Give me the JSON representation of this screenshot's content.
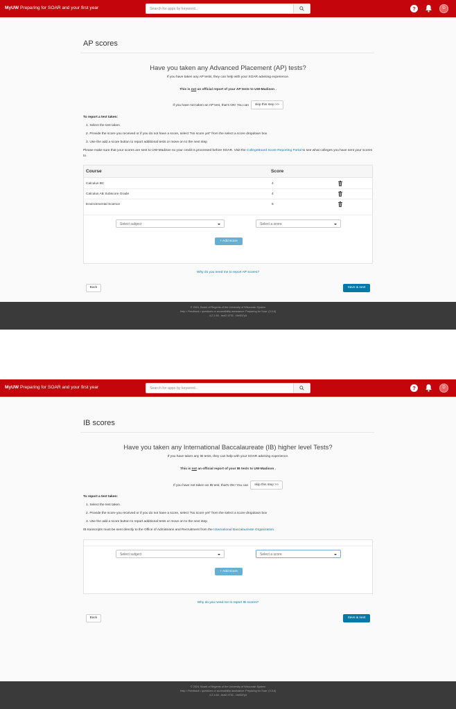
{
  "header": {
    "brand_bold": "MyUW",
    "brand_rest": " Preparing for SOAR and your first year",
    "search_placeholder": "Search for apps by keyword...",
    "avatar_letter": "D",
    "help_glyph": "?"
  },
  "ap": {
    "title": "AP scores",
    "question": "Have you taken any Advanced Placement (AP) tests?",
    "subtext": "If you have taken any AP tests, they can help with your SOAR advising experience.",
    "official_pre": "This is ",
    "official_not": "not",
    "official_post": " an official report of your AP tests to UW-Madison .",
    "skip_prompt": "If you have not taken an AP test, that's OK! You can",
    "skip_label": "skip this step >>",
    "instructions_head": "To report a test taken:",
    "instructions": [
      "1. Select the test taken",
      "2. Provide the score you received or if you do not have a score, select \"No score yet\" from the select a score dropdown box",
      "3. Use the add a score button to report additional tests or move on to the next step"
    ],
    "note_pre": "Please make sure that your scores are sent to UW-Madison so your credit is processed before SOAR. Visit the ",
    "note_link": "CollegeBoard Score Reporting Portal",
    "note_post": " to see what colleges you have sent your scores to.",
    "col_course": "Course",
    "col_score": "Score",
    "rows": [
      {
        "course": "Calculus BC",
        "score": "4"
      },
      {
        "course": "Calculus AB Subscore Grade",
        "score": "4"
      },
      {
        "course": "Environmental Science",
        "score": "5"
      }
    ],
    "select_subject": "Select subject",
    "select_score": "Select a score",
    "add_score": "+ Add score",
    "why": "Why do you need me to report AP scores?",
    "back": "Back",
    "save_next": "Save & next"
  },
  "ib": {
    "title": "IB scores",
    "question": "Have you taken any International Baccalaureate (IB) higher level Tests?",
    "subtext": "If you have taken any IB tests, they can help with your SOAR advising experience.",
    "official_pre": "This is ",
    "official_not": "not",
    "official_post": " an official report of your IB tests to UW-Madison .",
    "skip_prompt": "If you have not taken an IB test, that's OK! You can",
    "skip_label": "skip this step >>",
    "instructions_head": "To report a test taken:",
    "instructions": [
      "1. Select the test taken",
      "2. Provide the score you received or if you do not have a score, select \"No score yet\" from the select a score dropdown box",
      "3. Use the add a score button to report additional tests or move on to the next step"
    ],
    "note_pre": "IB transcripts must be sent directly to the Office of Admissions and Recruitment from the ",
    "note_link": "International Baccalaureate Organization",
    "note_post": ".",
    "select_subject": "Select subject",
    "select_score": "Select a score",
    "add_score": "+ Add score",
    "why": "Why do you need me to report IB scores?",
    "back": "Back",
    "save_next": "Save & next"
  },
  "footer": {
    "copyright": "© 2024, Board of Regents of the University of Wisconsin System",
    "links": "Help • Feedback • questions or accessibility assistance: Preparing for Soar: (3.0.6)",
    "version": "4.2.1.60 - text2-9731 - t4e637y3"
  },
  "colors": {
    "brand_red": "#c5050c",
    "link_blue": "#0479a8",
    "add_button": "#66afd0",
    "footer_bg": "#3a3a3a"
  },
  "icons": [
    "search-icon",
    "help-icon",
    "bell-icon",
    "trash-icon"
  ]
}
